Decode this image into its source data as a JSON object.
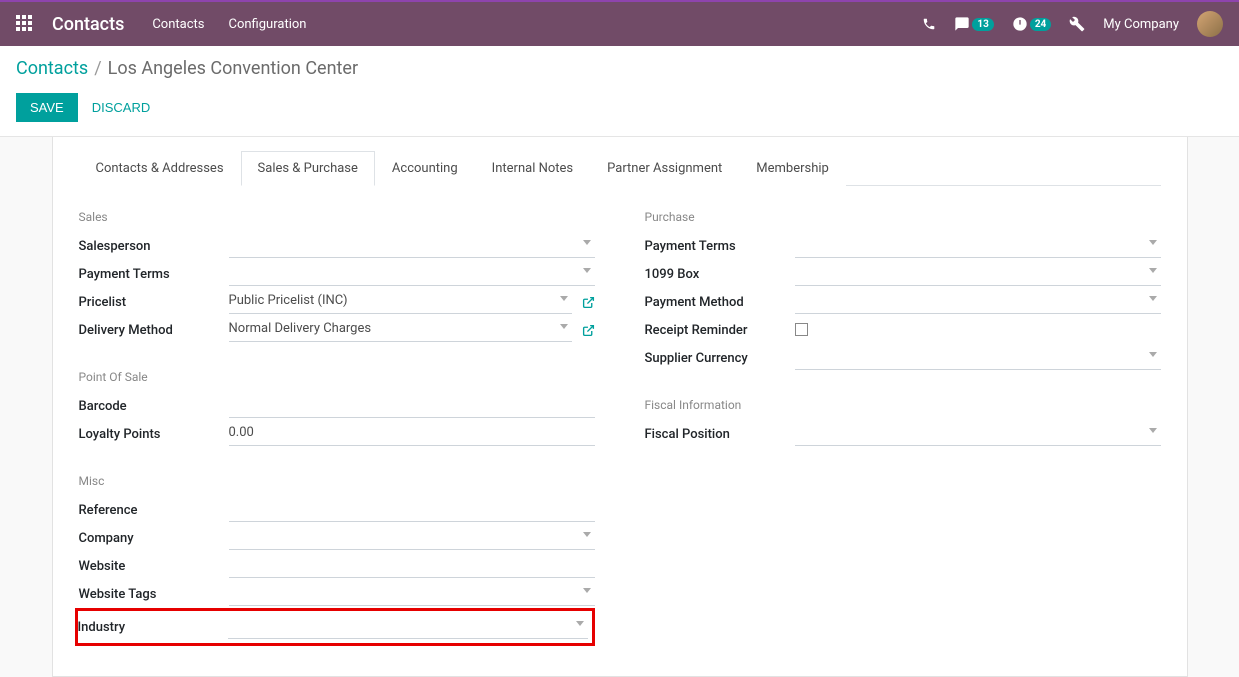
{
  "topnav": {
    "brand": "Contacts",
    "menu": [
      "Contacts",
      "Configuration"
    ],
    "badges": {
      "messages": "13",
      "activities": "24"
    },
    "company": "My Company"
  },
  "breadcrumb": {
    "root": "Contacts",
    "current": "Los Angeles Convention Center"
  },
  "buttons": {
    "save": "SAVE",
    "discard": "DISCARD"
  },
  "tabs": [
    "Contacts & Addresses",
    "Sales & Purchase",
    "Accounting",
    "Internal Notes",
    "Partner Assignment",
    "Membership"
  ],
  "activeTab": 1,
  "sections": {
    "sales": {
      "title": "Sales",
      "fields": {
        "salesperson": {
          "label": "Salesperson",
          "value": ""
        },
        "payment_terms": {
          "label": "Payment Terms",
          "value": ""
        },
        "pricelist": {
          "label": "Pricelist",
          "value": "Public Pricelist (INC)"
        },
        "delivery_method": {
          "label": "Delivery Method",
          "value": "Normal Delivery Charges"
        }
      }
    },
    "purchase": {
      "title": "Purchase",
      "fields": {
        "payment_terms": {
          "label": "Payment Terms",
          "value": ""
        },
        "box_1099": {
          "label": "1099 Box",
          "value": ""
        },
        "payment_method": {
          "label": "Payment Method",
          "value": ""
        },
        "receipt_reminder": {
          "label": "Receipt Reminder"
        },
        "supplier_currency": {
          "label": "Supplier Currency",
          "value": ""
        }
      }
    },
    "pos": {
      "title": "Point Of Sale",
      "fields": {
        "barcode": {
          "label": "Barcode",
          "value": ""
        },
        "loyalty_points": {
          "label": "Loyalty Points",
          "value": "0.00"
        }
      }
    },
    "fiscal": {
      "title": "Fiscal Information",
      "fields": {
        "fiscal_position": {
          "label": "Fiscal Position",
          "value": ""
        }
      }
    },
    "misc": {
      "title": "Misc",
      "fields": {
        "reference": {
          "label": "Reference",
          "value": ""
        },
        "company": {
          "label": "Company",
          "value": ""
        },
        "website": {
          "label": "Website",
          "value": ""
        },
        "website_tags": {
          "label": "Website Tags",
          "value": ""
        },
        "industry": {
          "label": "Industry",
          "value": ""
        }
      }
    }
  }
}
